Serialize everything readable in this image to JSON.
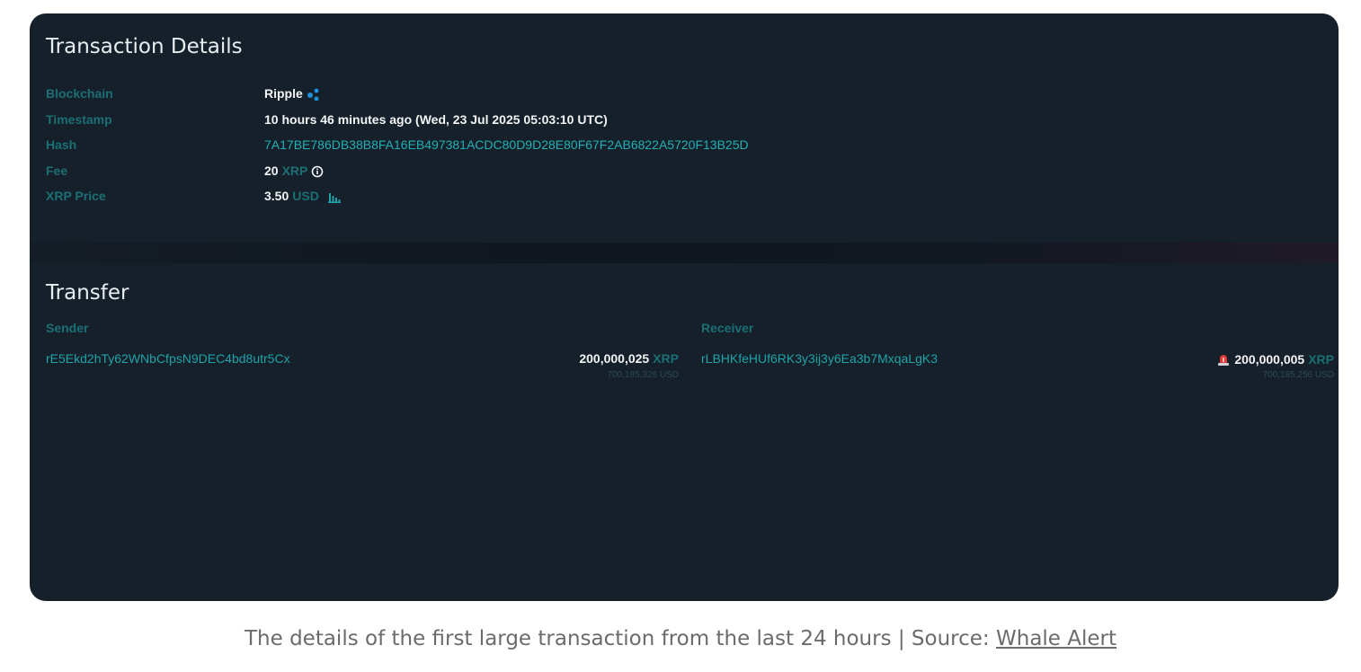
{
  "details": {
    "title": "Transaction Details",
    "rows": [
      {
        "label": "Blockchain",
        "value": "Ripple"
      },
      {
        "label": "Timestamp",
        "value": "10 hours 46 minutes ago (Wed, 23 Jul 2025 05:03:10 UTC)"
      },
      {
        "label": "Hash",
        "value": "7A17BE786DB38B8FA16EB497381ACDC80D9D28E80F67F2AB6822A5720F13B25D"
      },
      {
        "label": "Fee",
        "value": "20",
        "unit": "XRP"
      },
      {
        "label": "XRP Price",
        "value": "3.50",
        "unit": "USD"
      }
    ]
  },
  "transfer": {
    "title": "Transfer",
    "sender": {
      "label": "Sender",
      "address": "rE5Ekd2hTy62WNbCfpsN9DEC4bd8utr5Cx",
      "amount": "200,000,025",
      "unit": "XRP",
      "usd": "700,185,326 USD"
    },
    "receiver": {
      "label": "Receiver",
      "address": "rLBHKfeHUf6RK3y3ij3y6Ea3b7MxqaLgK3",
      "amount": "200,000,005",
      "unit": "XRP",
      "usd": "700,185,256 USD"
    }
  },
  "caption": {
    "text": "The details of the first large transaction from the last 24 hours | Source: ",
    "link": "Whale Alert"
  },
  "colors": {
    "card_bg": "#16202a",
    "label": "#1b6f75",
    "accent": "#1fa3a8",
    "text": "#f2f4f5"
  },
  "icons": [
    "ripple-logo-icon",
    "info-icon",
    "chart-icon",
    "siren-icon"
  ]
}
